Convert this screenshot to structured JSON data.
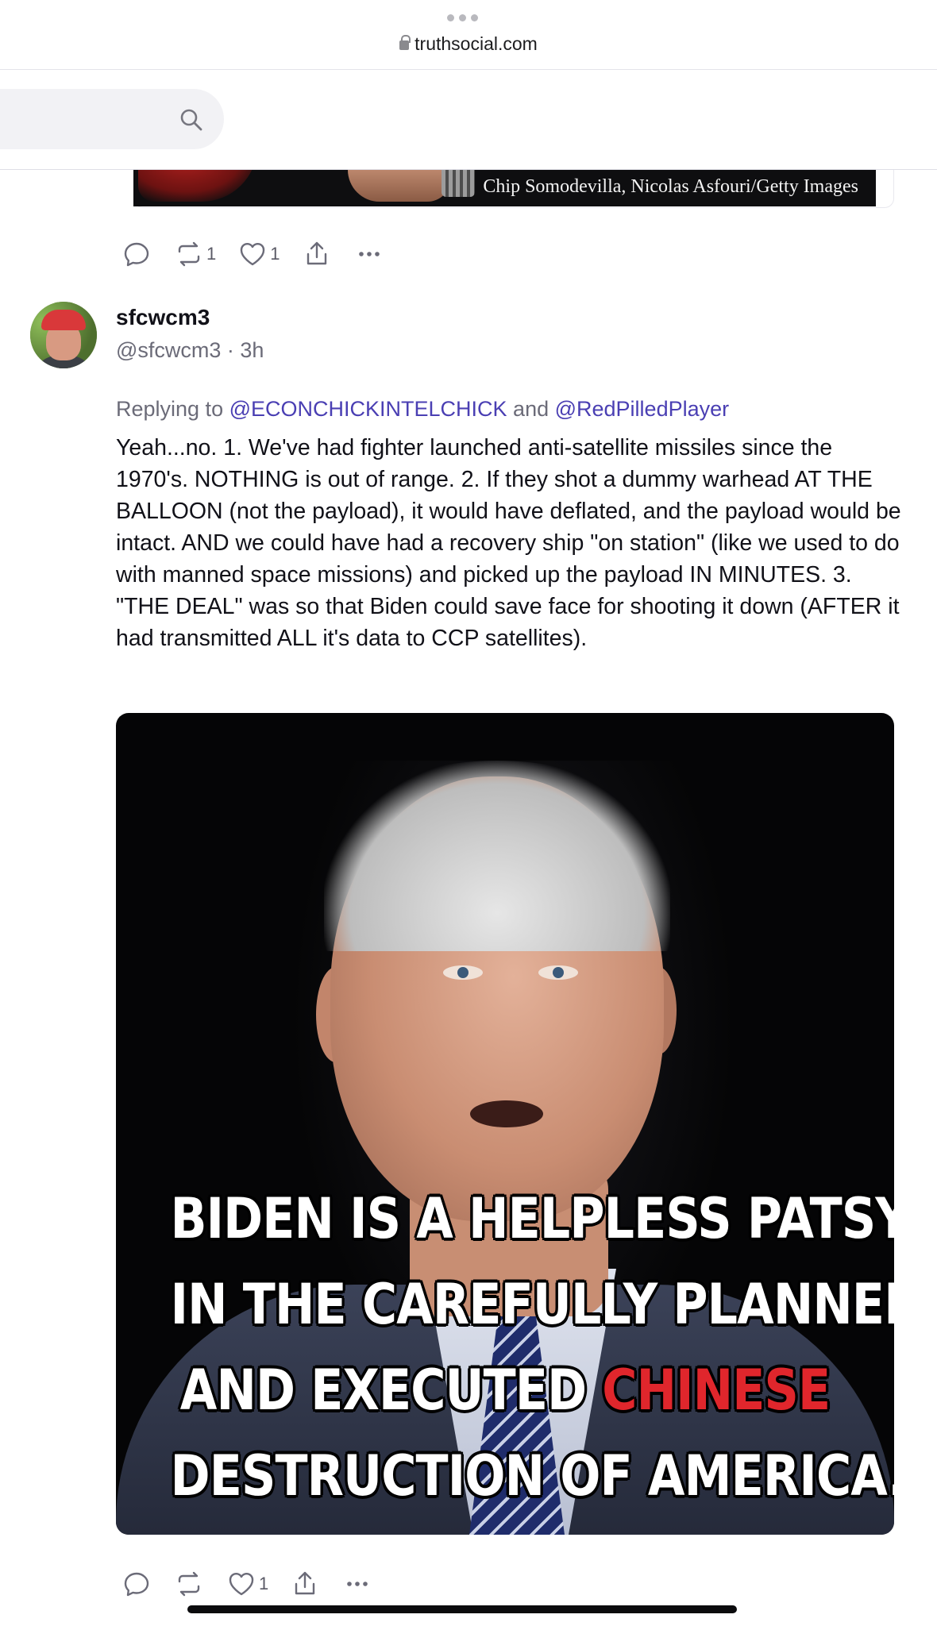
{
  "browser": {
    "domain": "truthsocial.com"
  },
  "previous_post": {
    "image_caption": "Chip Somodevilla, Nicolas Asfouri/Getty Images",
    "actions": {
      "reply_count": "",
      "repost_count": "1",
      "like_count": "1"
    }
  },
  "post": {
    "display_name": "sfcwcm3",
    "handle_time": "@sfcwcm3 · 3h",
    "replying_prefix": "Replying to ",
    "replying_user_1": "@ECONCHICKINTELCHICK",
    "replying_and": " and ",
    "replying_user_2": "@RedPilledPlayer",
    "body": "Yeah...no. 1. We've had fighter launched anti-satellite missiles since the 1970's. NOTHING is out of range. 2. If they shot a dummy warhead AT THE BALLOON (not the payload), it would have deflated, and the payload would be intact. AND we could have had a recovery ship \"on station\" (like we used to do with manned space missions) and picked up the payload IN MINUTES. 3. \"THE DEAL\" was so that Biden could save face for shooting it down (AFTER it had transmitted ALL it's data to CCP satellites).",
    "meme": {
      "line1": "BIDEN IS A HELPLESS PATSY",
      "line2": "IN THE CAREFULLY PLANNED",
      "line3_a": "AND EXECUTED ",
      "line3_b": "CHINESE",
      "line4": "DESTRUCTION OF AMERICA."
    },
    "actions": {
      "like_count": "1"
    }
  },
  "colors": {
    "accent_link": "#4a3fb3",
    "muted_text": "#6b6b78",
    "meme_highlight": "#e0262c"
  },
  "icons": [
    "lock-icon",
    "search-icon",
    "reply-icon",
    "repost-icon",
    "like-icon",
    "share-icon",
    "more-icon"
  ]
}
